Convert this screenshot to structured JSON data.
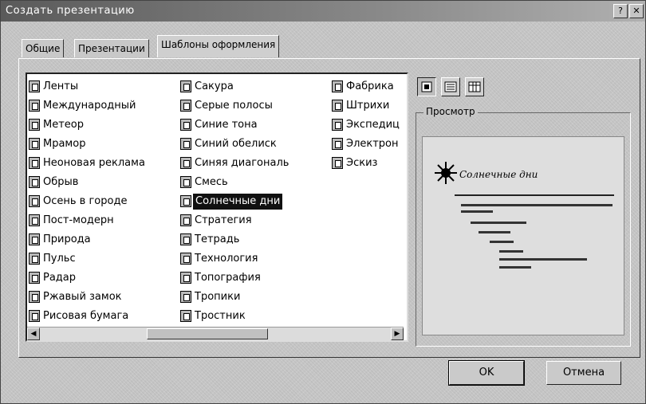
{
  "window": {
    "title": "Создать презентацию"
  },
  "tabs": [
    {
      "label": "Общие"
    },
    {
      "label": "Презентации"
    },
    {
      "label": "Шаблоны оформления"
    }
  ],
  "templates": {
    "column1": [
      "Ленты",
      "Международный",
      "Метеор",
      "Мрамор",
      "Неоновая реклама",
      "Обрыв",
      "Осень в городе",
      "Пост-модерн",
      "Природа",
      "Пульс",
      "Радар",
      "Ржавый замок",
      "Рисовая бумага"
    ],
    "column2": [
      "Сакура",
      "Серые полосы",
      "Синие тона",
      "Синий обелиск",
      "Синяя диагональ",
      "Смесь",
      "Солнечные дни",
      "Стратегия",
      "Тетрадь",
      "Технология",
      "Топография",
      "Тропики",
      "Тростник"
    ],
    "column3": [
      "Фабрика",
      "Штрихи",
      "Экспедиц",
      "Электрон",
      "Эскиз"
    ],
    "selected": "Солнечные дни"
  },
  "preview": {
    "label": "Просмотр",
    "slide_title": "Солнечные дни"
  },
  "buttons": {
    "ok": "OK",
    "cancel": "Отмена"
  },
  "icons": {
    "large": "large-icons-view-icon",
    "list": "list-view-icon",
    "details": "details-view-icon"
  }
}
